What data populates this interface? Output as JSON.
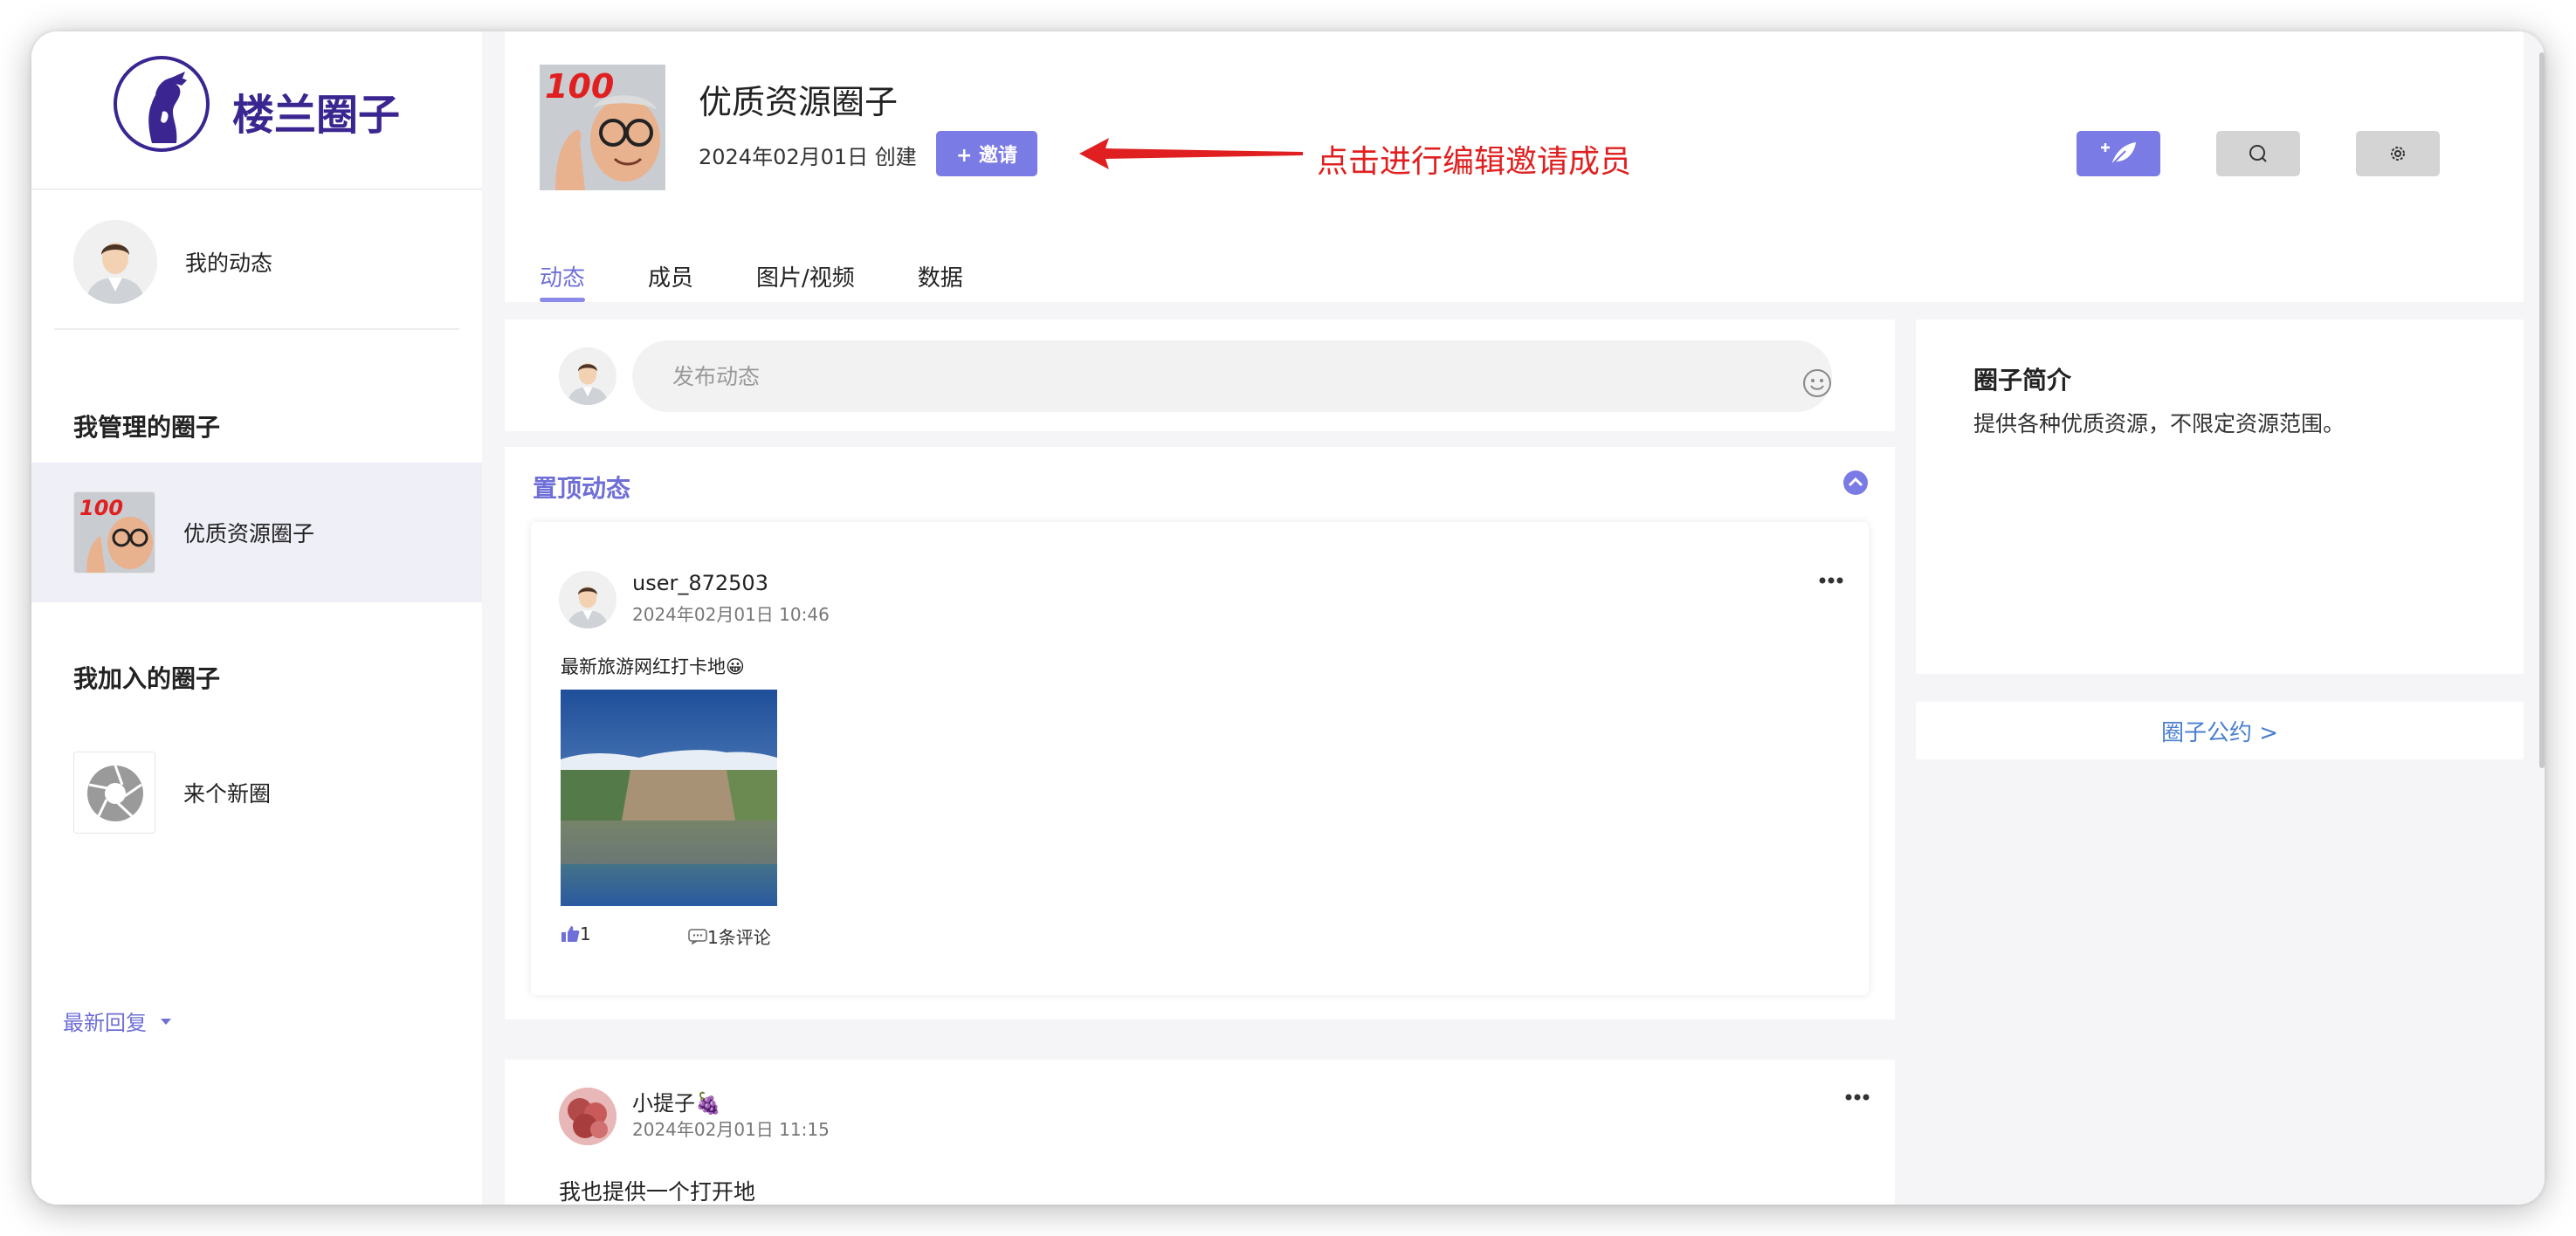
{
  "brand": {
    "name": "楼兰圈子",
    "logo_icon": "portrait-logo-icon"
  },
  "sidebar": {
    "my_feed_label": "我的动态",
    "managed_title": "我管理的圈子",
    "managed_items": [
      {
        "label": "优质资源圈子"
      }
    ],
    "joined_title": "我加入的圈子",
    "joined_items": [
      {
        "label": "来个新圈"
      }
    ]
  },
  "header": {
    "title": "优质资源圈子",
    "created": "2024年02月01日 创建",
    "invite_label": "+ 邀请",
    "annotation": "点击进行编辑邀请成员",
    "tools": [
      "post-feather-icon",
      "search-icon",
      "settings-gear-icon"
    ],
    "tabs": [
      {
        "label": "动态",
        "active": true
      },
      {
        "label": "成员",
        "active": false
      },
      {
        "label": "图片/视频",
        "active": false
      },
      {
        "label": "数据",
        "active": false
      }
    ]
  },
  "composer": {
    "placeholder": "发布动态"
  },
  "pinned": {
    "title": "置顶动态",
    "post": {
      "user": "user_872503",
      "time": "2024年02月01日 10:46",
      "text": "最新旅游网红打卡地😀",
      "likes": "1",
      "comments": "1条评论"
    }
  },
  "latest_reply_label": "最新回复",
  "reply": {
    "user": "小提子🍇",
    "time": "2024年02月01日 11:15",
    "text": "我也提供一个打开地"
  },
  "intro": {
    "title": "圈子简介",
    "text": "提供各种优质资源，不限定资源范围。"
  },
  "rules_link": "圈子公约 >",
  "colors": {
    "accent": "#7b7be6",
    "brand": "#3a2591",
    "annotation": "#e02020",
    "link": "#4a7fd0"
  }
}
